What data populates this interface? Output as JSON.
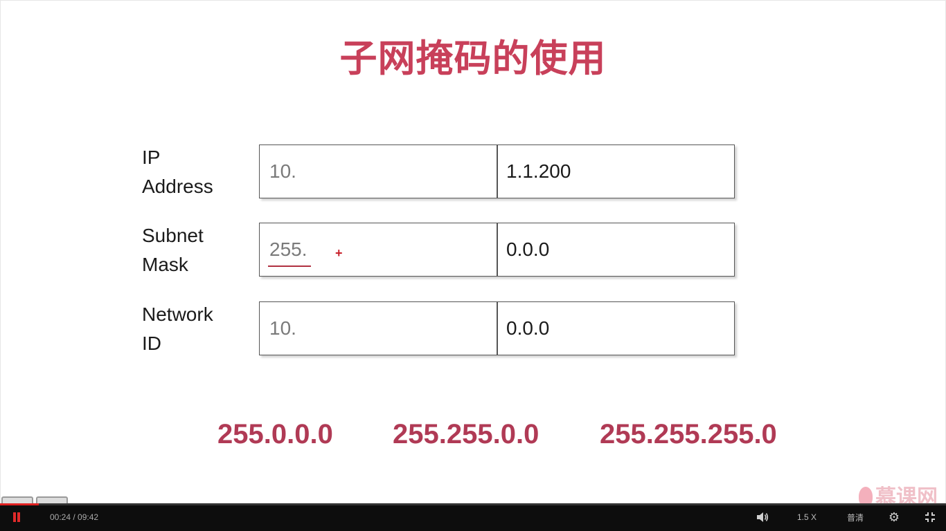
{
  "slide": {
    "title": "子网掩码的使用",
    "rows": [
      {
        "label_line1": "IP",
        "label_line2": "Address",
        "left": "10.",
        "right": "1.1.200"
      },
      {
        "label_line1": "Subnet",
        "label_line2": "Mask",
        "left": "255.",
        "right": "0.0.0"
      },
      {
        "label_line1": "Network",
        "label_line2": "ID",
        "left": "10.",
        "right": "0.0.0"
      }
    ],
    "masks": [
      "255.0.0.0",
      "255.255.0.0",
      "255.255.255.0"
    ],
    "logo": "慕课网"
  },
  "player": {
    "time_current": "00:24",
    "time_total": "09:42",
    "time_display": "00:24 / 09:42",
    "progress_fraction": 0.041,
    "speed": "1.5 X",
    "quality": "普清",
    "icons": [
      "pause-icon",
      "volume-icon",
      "settings-gear-icon",
      "exit-fullscreen-icon"
    ],
    "accent_color": "#e02020"
  }
}
